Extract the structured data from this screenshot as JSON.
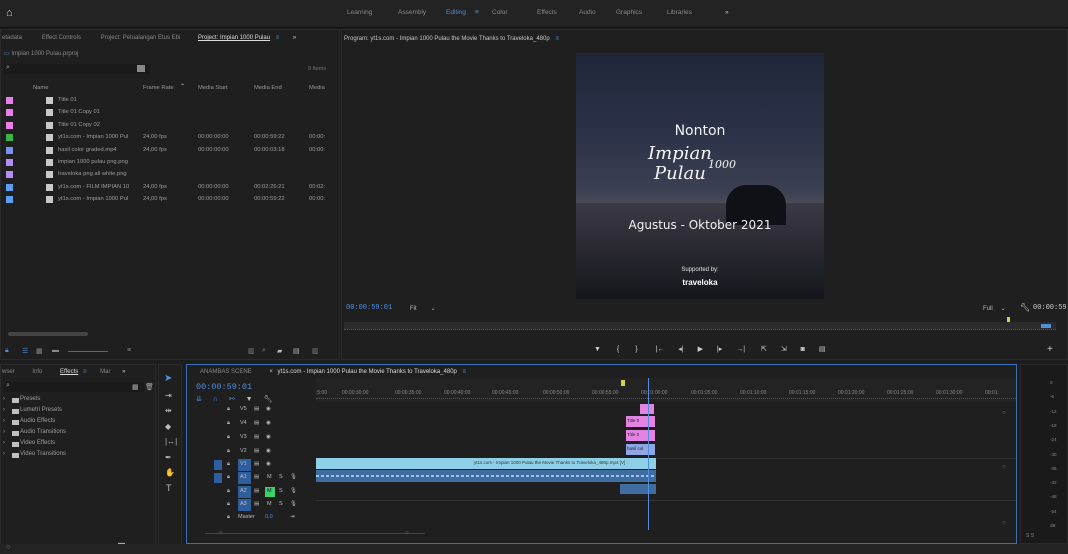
{
  "workspaces": [
    "Learning",
    "Assembly",
    "Editing",
    "Color",
    "Effects",
    "Audio",
    "Graphics",
    "Libraries"
  ],
  "workspaces_more": "»",
  "project_panel": {
    "tabs": [
      "etadata",
      "Effect Controls",
      "Project: Petualangan Etus Ebi",
      "Project: Impian 1000 Pulau"
    ],
    "more": "»",
    "file": "Impian 1000 Pulau.prproj",
    "items_count": "9 Items",
    "columns": [
      "Name",
      "Frame Rate",
      "Media Start",
      "Media End",
      "Media"
    ],
    "rows": [
      {
        "color": "#e87ee8",
        "name": "Title 01",
        "fps": "",
        "start": "",
        "end": "",
        "media": ""
      },
      {
        "color": "#e87ee8",
        "name": "Title 01 Copy 01",
        "fps": "",
        "start": "",
        "end": "",
        "media": ""
      },
      {
        "color": "#e87ee8",
        "name": "Title 01 Copy 02",
        "fps": "",
        "start": "",
        "end": "",
        "media": ""
      },
      {
        "color": "#3bb54a",
        "name": "yt1s.com - Impian 1000 Pul",
        "fps": "24,00 fps",
        "start": "00:00:00:00",
        "end": "00:00:59:22",
        "media": "00:00:"
      },
      {
        "color": "#7b8ff0",
        "name": "hasil color graded.mp4",
        "fps": "24,00 fps",
        "start": "00:00:00:00",
        "end": "00:00:03:18",
        "media": "00:00:"
      },
      {
        "color": "#b58cf0",
        "name": "impian 1000 pulau png.png",
        "fps": "",
        "start": "",
        "end": "",
        "media": ""
      },
      {
        "color": "#b58cf0",
        "name": "traveloka png all white.png",
        "fps": "",
        "start": "",
        "end": "",
        "media": ""
      },
      {
        "color": "#5a9ff0",
        "name": "yt1s.com - FILM IMPIAN 10",
        "fps": "24,00 fps",
        "start": "00:00:00:00",
        "end": "00:02:26:21",
        "media": "00:02:"
      },
      {
        "color": "#5a9ff0",
        "name": "yt1s.com - Impian 1000 Pul",
        "fps": "24,00 fps",
        "start": "00:00:00:00",
        "end": "00:00:59:22",
        "media": "00:00:"
      }
    ]
  },
  "program_monitor": {
    "title": "Program: yt1s.com - Impian 1000 Pulau the Movie  Thanks to Traveloka_480p",
    "timecode": "00:00:59:01",
    "fit": "Fit",
    "quality": "Full",
    "duration": "00:00:59:23",
    "frame": {
      "line1": "Nonton",
      "line2": "Impian",
      "line3": "Pulau",
      "line_number": "1000",
      "line4": "Agustus - Oktober 2021",
      "supported": "Supported by:",
      "brand": "traveloka"
    }
  },
  "effects_panel": {
    "tabs": [
      "wser",
      "Info",
      "Effects",
      "Mar"
    ],
    "more": "»",
    "items": [
      "Presets",
      "Lumetri Presets",
      "Audio Effects",
      "Audio Transitions",
      "Video Effects",
      "Video Transitions"
    ]
  },
  "timeline": {
    "tabs": [
      "ANAMBAS SCENE",
      "yt1s.com - Impian 1000 Pulau the Movie  Thanks to Traveloka_480p"
    ],
    "timecode": "00:00:59:01",
    "ruler": [
      ":5:00",
      "00:00:30:00",
      "00:00:35:00",
      "00:00:40:00",
      "00:00:45:00",
      "00:00:50:00",
      "00:00:55:00",
      "00:01:00:00",
      "00:01:05:00",
      "00:01:10:00",
      "00:01:15:00",
      "00:01:20:00",
      "00:01:25:00",
      "00:01:30:00",
      "00:01:"
    ],
    "video_tracks": [
      "V5",
      "V4",
      "V3",
      "V2",
      "V1"
    ],
    "audio_tracks": [
      "A1",
      "A2",
      "A3"
    ],
    "master": "Master",
    "master_val": "0,0",
    "clips": {
      "v4": "Title 0",
      "v3": "Title 0",
      "v2": "hasil col",
      "v1": "yt1s.com - Impian 1000 Pulau the Movie  Thanks to Traveloka_480p.mp4 [V]"
    }
  },
  "meter_labels": [
    "0",
    "-6",
    "-12",
    "-18",
    "-24",
    "-30",
    "-36",
    "-42",
    "-48",
    "-54",
    "dB"
  ],
  "meter_footer": "S  S",
  "colors": {
    "accent": "#4f8fde",
    "title_clip": "#e583e5",
    "video_clip": "#8ecfe8",
    "audio_clip": "#3f6da1"
  }
}
